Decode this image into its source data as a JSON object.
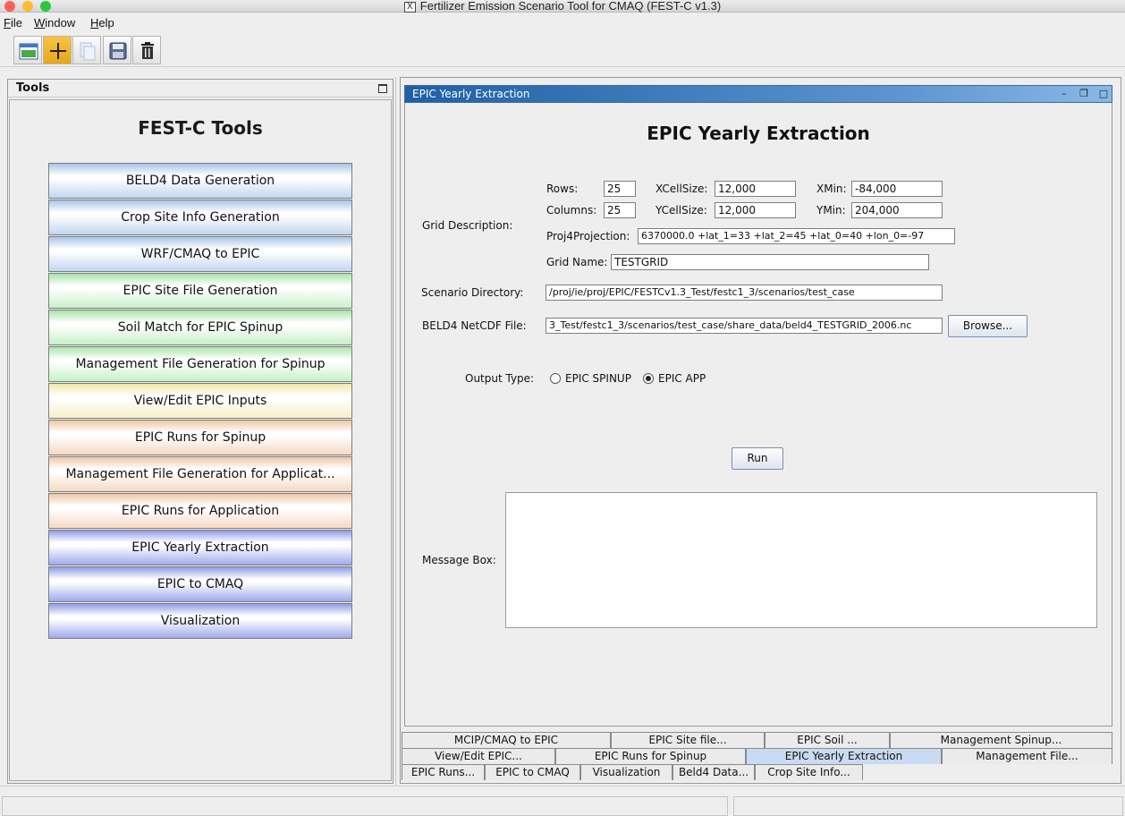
{
  "window": {
    "title": "Fertilizer Emission Scenario Tool for CMAQ (FEST-C v1.3)",
    "app_icon": "X",
    "traffic_lights": {
      "close": "#fe5f57",
      "minimize": "#febc2e",
      "zoom": "#28c840"
    }
  },
  "menubar": [
    "File",
    "Window",
    "Help"
  ],
  "toolbar": [
    {
      "name": "open-icon"
    },
    {
      "name": "new-icon"
    },
    {
      "name": "copy-icon"
    },
    {
      "name": "save-icon"
    },
    {
      "name": "delete-icon"
    }
  ],
  "tools_panel": {
    "header": "Tools",
    "title": "FEST-C Tools",
    "buttons": [
      {
        "label": "BELD4 Data Generation",
        "color": "blue"
      },
      {
        "label": "Crop Site Info Generation",
        "color": "blue"
      },
      {
        "label": "WRF/CMAQ to EPIC",
        "color": "blue"
      },
      {
        "label": "EPIC Site File Generation",
        "color": "green"
      },
      {
        "label": "Soil Match for EPIC Spinup",
        "color": "green"
      },
      {
        "label": "Management File Generation for Spinup",
        "color": "green"
      },
      {
        "label": "View/Edit EPIC Inputs",
        "color": "yellow"
      },
      {
        "label": "EPIC Runs for Spinup",
        "color": "peach"
      },
      {
        "label": "Management File Generation for Applicat...",
        "color": "peach"
      },
      {
        "label": "EPIC Runs for Application",
        "color": "peach"
      },
      {
        "label": "EPIC Yearly Extraction",
        "color": "purple"
      },
      {
        "label": "EPIC to CMAQ",
        "color": "purple"
      },
      {
        "label": "Visualization",
        "color": "purple"
      }
    ]
  },
  "frame": {
    "title": "EPIC Yearly Extraction",
    "heading": "EPIC Yearly Extraction",
    "grid": {
      "section_label": "Grid Description:",
      "rows_label": "Rows:",
      "rows": "25",
      "columns_label": "Columns:",
      "columns": "25",
      "xcell_label": "XCellSize:",
      "xcell": "12,000",
      "ycell_label": "YCellSize:",
      "ycell": "12,000",
      "xmin_label": "XMin:",
      "xmin": "-84,000",
      "ymin_label": "YMin:",
      "ymin": "204,000",
      "proj_label": "Proj4Projection:",
      "proj": "6370000.0 +lat_1=33 +lat_2=45 +lat_0=40 +lon_0=-97",
      "name_label": "Grid Name:",
      "name": "TESTGRID"
    },
    "scenario_label": "Scenario Directory:",
    "scenario_dir": "/proj/ie/proj/EPIC/FESTCv1.3_Test/festc1_3/scenarios/test_case",
    "beld4_label": "BELD4 NetCDF File:",
    "beld4_file": "3_Test/festc1_3/scenarios/test_case/share_data/beld4_TESTGRID_2006.nc",
    "browse_label": "Browse...",
    "output_type_label": "Output Type:",
    "output_options": [
      {
        "label": "EPIC SPINUP",
        "selected": false
      },
      {
        "label": "EPIC APP",
        "selected": true
      }
    ],
    "run_label": "Run",
    "message_label": "Message Box:",
    "message": ""
  },
  "tabs": {
    "row1": [
      "MCIP/CMAQ to EPIC",
      "EPIC Site file...",
      "EPIC Soil ...",
      "Management Spinup..."
    ],
    "row2": [
      "View/Edit EPIC...",
      "EPIC Runs for Spinup",
      "EPIC Yearly Extraction",
      "Management File..."
    ],
    "row3": [
      "EPIC Runs...",
      "EPIC to CMAQ",
      "Visualization",
      "Beld4 Data...",
      "Crop Site Info..."
    ],
    "selected": "EPIC Yearly Extraction"
  }
}
